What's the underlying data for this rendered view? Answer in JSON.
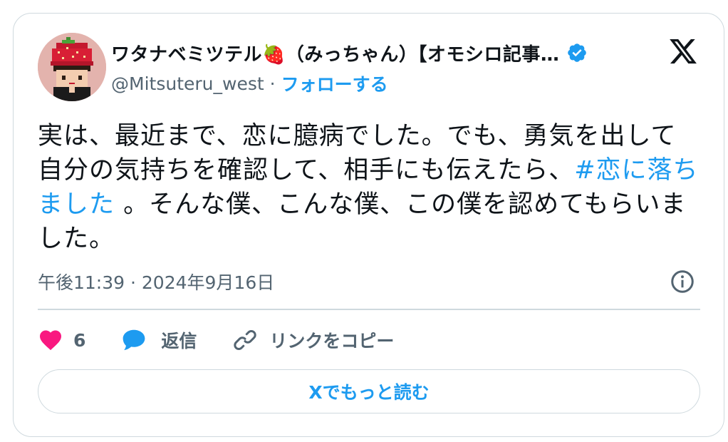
{
  "tweet": {
    "author": {
      "display_name": "ワタナベミツテル🍓（みっちゃん）【オモシロ記事…",
      "handle": "@Mitsuteru_west",
      "separator": "·",
      "follow_label": "フォローする",
      "avatar_icon": "pixel-art-strawberry-hat-avatar",
      "verified_icon": "verified-badge-icon"
    },
    "text_before": "実は、最近まで、恋に臆病でした。でも、勇気を出して自分の気持ちを確認して、相手にも伝えたら、",
    "hashtag": "#恋に落ちました",
    "text_after": " 。そんな僕、こんな僕、この僕を認めてもらいました。",
    "timestamp": "午後11:39 · 2024年9月16日",
    "actions": {
      "like_count": "6",
      "reply_label": "返信",
      "copy_link_label": "リンクをコピー"
    },
    "read_more_label": "Xでもっと読む"
  },
  "colors": {
    "accent": "#1d9bf0",
    "like": "#f91880",
    "muted": "#536471",
    "border": "#cfd9de",
    "text": "#0f1419"
  }
}
